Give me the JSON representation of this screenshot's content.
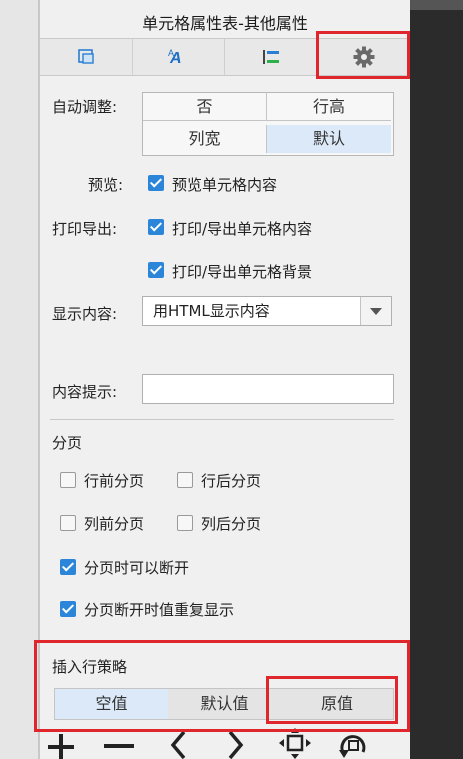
{
  "panel": {
    "title": "单元格属性表-其他属性"
  },
  "tabs": [
    {
      "name": "cell-style-tab",
      "icon": "cell-style-icon"
    },
    {
      "name": "font-tab",
      "icon": "font-icon"
    },
    {
      "name": "align-tab",
      "icon": "align-icon"
    },
    {
      "name": "other-props-tab",
      "icon": "gear-icon",
      "selected": true
    }
  ],
  "auto_adjust": {
    "label": "自动调整:",
    "options": [
      "否",
      "行高",
      "列宽",
      "默认"
    ],
    "selected": "默认"
  },
  "preview": {
    "label": "预览:",
    "checkbox_label": "预览单元格内容",
    "checked": true
  },
  "print_export": {
    "label": "打印导出:",
    "items": [
      {
        "text": "打印/导出单元格内容",
        "checked": true
      },
      {
        "text": "打印/导出单元格背景",
        "checked": true
      }
    ]
  },
  "display_content": {
    "label": "显示内容:",
    "value": "用HTML显示内容"
  },
  "content_tip": {
    "label": "内容提示:",
    "value": ""
  },
  "pagination": {
    "heading": "分页",
    "options": [
      {
        "text": "行前分页",
        "checked": false
      },
      {
        "text": "行后分页",
        "checked": false
      },
      {
        "text": "列前分页",
        "checked": false
      },
      {
        "text": "列后分页",
        "checked": false
      },
      {
        "text": "分页时可以断开",
        "checked": true
      },
      {
        "text": "分页断开时值重复显示",
        "checked": true
      }
    ]
  },
  "insert_policy": {
    "heading": "插入行策略",
    "options": [
      "空值",
      "默认值",
      "原值"
    ],
    "selected": "空值"
  },
  "toolbar_icons": [
    "plus-icon",
    "minus-icon",
    "chevron-left-icon",
    "chevron-right-icon",
    "move-icon",
    "rotate-icon"
  ],
  "colors": {
    "highlight": "#e0262d",
    "checkbox": "#2b86d9",
    "selected_cell": "#dce9f8"
  }
}
